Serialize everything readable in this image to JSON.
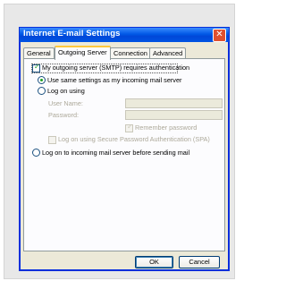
{
  "window": {
    "title": "Internet E-mail Settings"
  },
  "tabs": [
    {
      "label": "General"
    },
    {
      "label": "Outgoing Server"
    },
    {
      "label": "Connection"
    },
    {
      "label": "Advanced"
    }
  ],
  "outgoing": {
    "requires_auth_label": "My outgoing server (SMTP) requires authentication",
    "requires_auth_checked": true,
    "use_same_label": "Use same settings as my incoming mail server",
    "use_same_selected": true,
    "logon_using_label": "Log on using",
    "username_label": "User Name:",
    "password_label": "Password:",
    "remember_label": "Remember password",
    "remember_checked": true,
    "spa_label": "Log on using Secure Password Authentication (SPA)",
    "spa_checked": false,
    "logon_before_label": "Log on to incoming mail server before sending mail"
  },
  "buttons": {
    "ok": "OK",
    "cancel": "Cancel"
  },
  "colors": {
    "titlebar": "#0054e3",
    "dialog_bg": "#ece9d8",
    "accent_tab": "#ffc83c"
  }
}
